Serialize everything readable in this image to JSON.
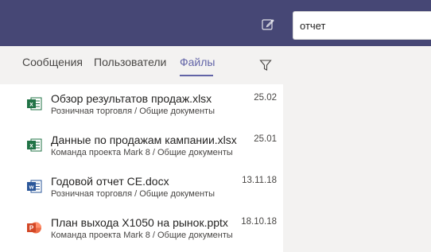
{
  "header": {
    "search_value": "отчет",
    "compose_icon": "compose-icon"
  },
  "tabs": [
    {
      "label": "Сообщения"
    },
    {
      "label": "Пользователи"
    },
    {
      "label": "Файлы",
      "active": true
    }
  ],
  "filter_icon": "filter-icon",
  "files": [
    {
      "name": "Обзор результатов продаж.xlsx",
      "path": "Розничная торговля / Общие документы",
      "date": "25.02",
      "type": "excel-icon"
    },
    {
      "name": "Данные по продажам кампании.xlsx",
      "path": "Команда проекта Mark 8 / Общие документы",
      "date": "25.01",
      "type": "excel-icon"
    },
    {
      "name": "Годовой отчет CE.docx",
      "path": "Розничная торговля / Общие документы",
      "date": "13.11.18",
      "type": "word-icon"
    },
    {
      "name": "План выхода X1050 на рынок.pptx",
      "path": "Команда проекта Mark 8 / Общие документы",
      "date": "18.10.18",
      "type": "powerpoint-icon"
    }
  ],
  "colors": {
    "brand": "#464775",
    "accent": "#6264a7",
    "excel": "#217346",
    "word": "#2b579a",
    "powerpoint": "#d24726"
  }
}
